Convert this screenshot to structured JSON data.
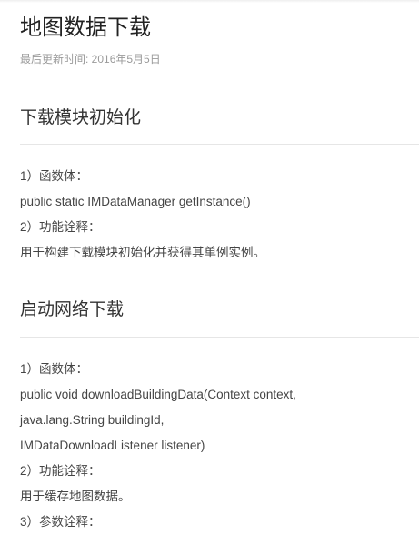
{
  "page": {
    "title": "地图数据下载",
    "last_updated": "最后更新时间: 2016年5月5日"
  },
  "sections": [
    {
      "title": "下载模块初始化",
      "lines": [
        "1）函数体：",
        "public static IMDataManager getInstance()",
        "2）功能诠释：",
        "用于构建下载模块初始化并获得其单例实例。"
      ]
    },
    {
      "title": "启动网络下载",
      "lines": [
        "1）函数体：",
        "public void downloadBuildingData(Context context,",
        "java.lang.String buildingId,",
        "IMDataDownloadListener listener)",
        "2）功能诠释：",
        "用于缓存地图数据。",
        "3）参数诠释："
      ]
    }
  ]
}
